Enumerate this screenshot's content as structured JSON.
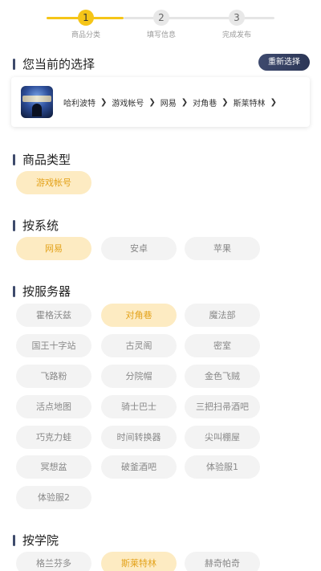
{
  "stepper": {
    "steps": [
      {
        "num": "1",
        "label": "商品分类"
      },
      {
        "num": "2",
        "label": "填写信息"
      },
      {
        "num": "3",
        "label": "完成发布"
      }
    ]
  },
  "current": {
    "title": "您当前的选择",
    "reselect_label": "重新选择",
    "breadcrumbs": [
      "哈利波特",
      "游戏帐号",
      "网易",
      "对角巷",
      "斯莱特林"
    ]
  },
  "product_type": {
    "title": "商品类型",
    "options": [
      "游戏帐号"
    ]
  },
  "system": {
    "title": "按系统",
    "options": [
      "网易",
      "安卓",
      "苹果"
    ]
  },
  "server": {
    "title": "按服务器",
    "options": [
      "霍格沃兹",
      "对角巷",
      "魔法部",
      "国王十字站",
      "古灵阁",
      "密室",
      "飞路粉",
      "分院帽",
      "金色飞贼",
      "活点地图",
      "骑士巴士",
      "三把扫帚酒吧",
      "巧克力蛙",
      "时间转换器",
      "尖叫棚屋",
      "冥想盆",
      "破釜酒吧",
      "体验服1",
      "体验服2"
    ]
  },
  "college": {
    "title": "按学院",
    "options": [
      "格兰芬多",
      "斯莱特林",
      "赫奇帕奇"
    ]
  }
}
